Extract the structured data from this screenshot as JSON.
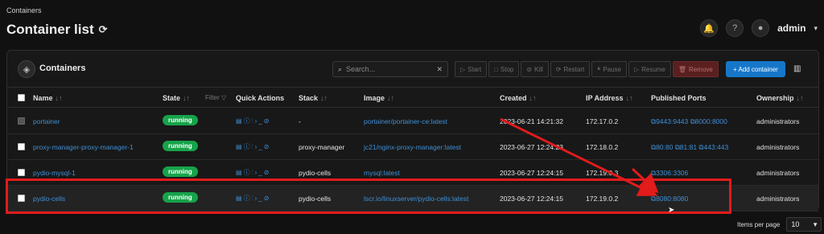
{
  "breadcrumb": "Containers",
  "page_title": "Container list",
  "user": {
    "name": "admin"
  },
  "panel": {
    "title": "Containers",
    "search_placeholder": "Search...",
    "buttons": {
      "start": "Start",
      "stop": "Stop",
      "kill": "Kill",
      "restart": "Restart",
      "pause": "Pause",
      "resume": "Resume",
      "remove": "Remove",
      "add": "+ Add container"
    }
  },
  "table": {
    "headers": {
      "name": "Name",
      "state": "State",
      "filter": "Filter",
      "quick_actions": "Quick Actions",
      "stack": "Stack",
      "image": "Image",
      "created": "Created",
      "ip": "IP Address",
      "ports": "Published Ports",
      "ownership": "Ownership"
    },
    "rows": [
      {
        "name": "portainer",
        "state": "running",
        "stack": "-",
        "image": "portainer/portainer-ce:latest",
        "created": "2023-06-21 14:21:32",
        "ip": "172.17.0.2",
        "ports": "⧉9443:9443 ⧉8000:8000",
        "ownership": "administrators"
      },
      {
        "name": "proxy-manager-proxy-manager-1",
        "state": "running",
        "stack": "proxy-manager",
        "image": "jc21/nginx-proxy-manager:latest",
        "created": "2023-06-27 12:24:23",
        "ip": "172.18.0.2",
        "ports": "⧉80:80 ⧉81:81 ⧉443:443",
        "ownership": "administrators"
      },
      {
        "name": "pydio-mysql-1",
        "state": "running",
        "stack": "pydio-cells",
        "image": "mysql:latest",
        "created": "2023-06-27 12:24:15",
        "ip": "172.19.0.3",
        "ports": "⧉3306:3306",
        "ownership": "administrators"
      },
      {
        "name": "pydio-cells",
        "state": "running",
        "stack": "pydio-cells",
        "image": "lscr.io/linuxserver/pydio-cells:latest",
        "created": "2023-06-27 12:24:15",
        "ip": "172.19.0.2",
        "ports": "⧉8080:8080",
        "ownership": "administrators"
      }
    ]
  },
  "pagination": {
    "label": "Items per page",
    "value": "10"
  },
  "colors": {
    "accent": "#1677c9",
    "running": "#16a34a",
    "link": "#3f8fd6",
    "annotation": "#e21b1b"
  }
}
